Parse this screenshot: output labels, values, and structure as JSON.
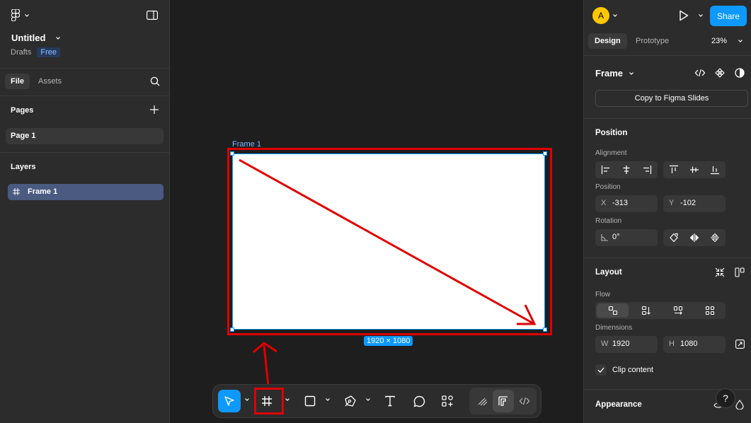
{
  "left_panel": {
    "file_name": "Untitled",
    "location": "Drafts",
    "plan_badge": "Free",
    "tabs": {
      "file": "File",
      "assets": "Assets"
    },
    "pages_header": "Pages",
    "pages": [
      "Page 1"
    ],
    "layers_header": "Layers",
    "layers": [
      "Frame 1"
    ]
  },
  "canvas": {
    "frame_label": "Frame 1",
    "size_badge": "1920 × 1080",
    "frame_fill": "#ffffff",
    "selection_color": "#0d99ff",
    "annotation_color": "#e00000"
  },
  "toolbar": {
    "active_tool": "move",
    "highlighted_tool": "frame"
  },
  "right_panel": {
    "avatar_letter": "A",
    "share_label": "Share",
    "tabs": {
      "design": "Design",
      "prototype": "Prototype"
    },
    "zoom": "23%",
    "selection_type": "Frame",
    "copy_to_slides": "Copy to Figma Slides",
    "position_section": "Position",
    "alignment_label": "Alignment",
    "position_label": "Position",
    "x_label": "X",
    "x_value": "-313",
    "y_label": "Y",
    "y_value": "-102",
    "rotation_label": "Rotation",
    "rotation_value": "0°",
    "layout_section": "Layout",
    "flow_label": "Flow",
    "dimensions_label": "Dimensions",
    "w_label": "W",
    "w_value": "1920",
    "h_label": "H",
    "h_value": "1080",
    "clip_content_label": "Clip content",
    "clip_content_checked": true,
    "appearance_section": "Appearance",
    "help_label": "?"
  },
  "colors": {
    "accent": "#0d99ff",
    "panel": "#2c2c2c",
    "canvas": "#1e1e1e",
    "avatar": "#ffc700"
  }
}
